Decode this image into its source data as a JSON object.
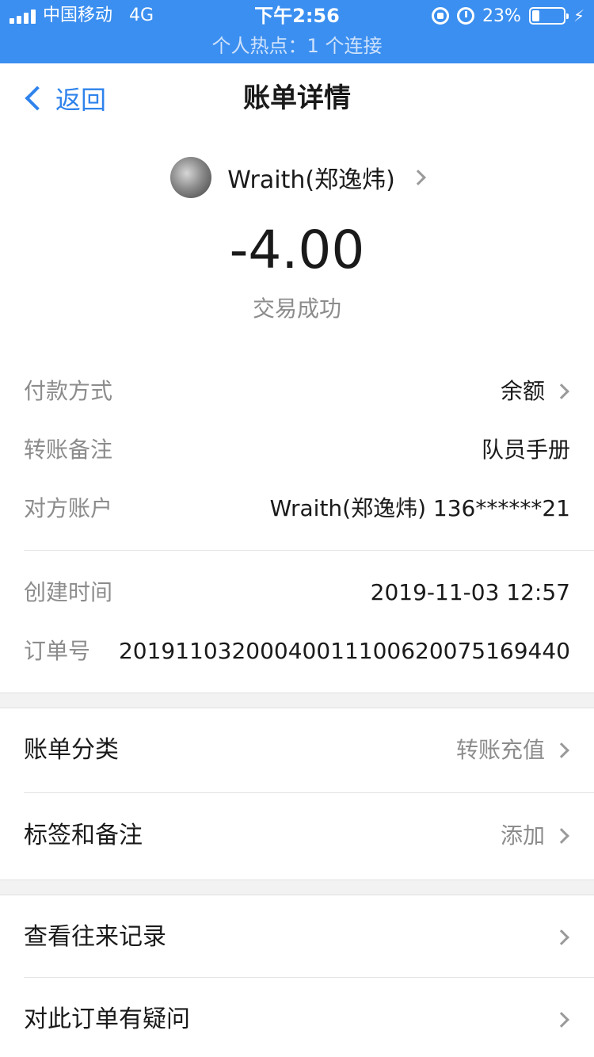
{
  "status_bar": {
    "carrier": "中国移动",
    "network": "4G",
    "time": "下午2:56",
    "battery": "23%",
    "battery_level": 0.23,
    "hotspot": "个人热点：1 个连接"
  },
  "nav": {
    "back_label": "返回",
    "title": "账单详情"
  },
  "payee": {
    "name": "Wraith(郑逸炜)"
  },
  "amount": "-4.00",
  "trade_status": "交易成功",
  "details": [
    {
      "label": "付款方式",
      "value": "余额"
    },
    {
      "label": "转账备注",
      "value": "队员手册"
    },
    {
      "label": "对方账户",
      "value": "Wraith(郑逸炜) 136******21"
    }
  ],
  "meta": [
    {
      "label": "创建时间",
      "value": "2019-11-03 12:57"
    },
    {
      "label": "订单号",
      "value": "20191103200040011100620075169440"
    }
  ],
  "settings": [
    {
      "label": "账单分类",
      "value": "转账充值"
    },
    {
      "label": "标签和备注",
      "value": "添加"
    }
  ],
  "actions": [
    {
      "label": "查看往来记录"
    },
    {
      "label": "对此订单有疑问"
    }
  ]
}
